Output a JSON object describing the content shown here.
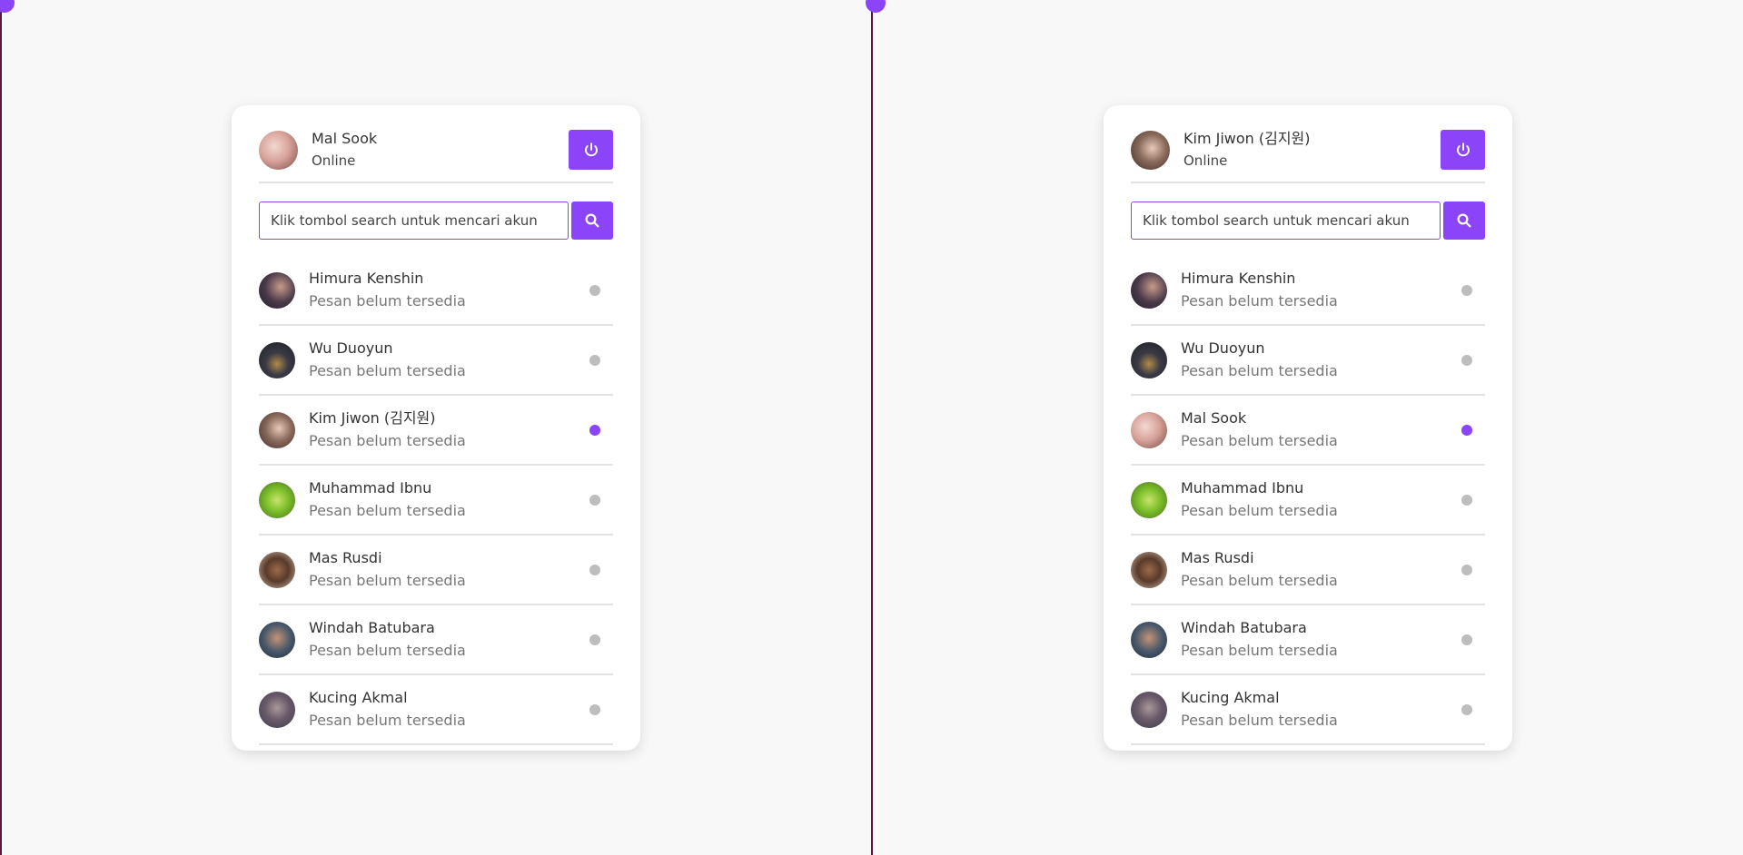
{
  "colors": {
    "accent": "#8b44f7",
    "background": "#f8f8f8",
    "divider": "#e2e2e2",
    "dot_inactive": "#bdbdbd"
  },
  "panes": [
    {
      "user": {
        "name": "Mal Sook",
        "status": "Online",
        "avatar": "user-avatar"
      },
      "search": {
        "placeholder": "Klik tombol search untuk mencari akun"
      },
      "contacts": [
        {
          "name": "Himura Kenshin",
          "message": "Pesan belum tersedia",
          "online": false
        },
        {
          "name": "Wu Duoyun",
          "message": "Pesan belum tersedia",
          "online": false
        },
        {
          "name": "Kim Jiwon (김지원)",
          "message": "Pesan belum tersedia",
          "online": true
        },
        {
          "name": "Muhammad Ibnu",
          "message": "Pesan belum tersedia",
          "online": false
        },
        {
          "name": "Mas Rusdi",
          "message": "Pesan belum tersedia",
          "online": false
        },
        {
          "name": "Windah Batubara",
          "message": "Pesan belum tersedia",
          "online": false
        },
        {
          "name": "Kucing Akmal",
          "message": "Pesan belum tersedia",
          "online": false
        }
      ]
    },
    {
      "user": {
        "name": "Kim Jiwon (김지원)",
        "status": "Online",
        "avatar": "user-avatar"
      },
      "search": {
        "placeholder": "Klik tombol search untuk mencari akun"
      },
      "contacts": [
        {
          "name": "Himura Kenshin",
          "message": "Pesan belum tersedia",
          "online": false
        },
        {
          "name": "Wu Duoyun",
          "message": "Pesan belum tersedia",
          "online": false
        },
        {
          "name": "Mal Sook",
          "message": "Pesan belum tersedia",
          "online": true
        },
        {
          "name": "Muhammad Ibnu",
          "message": "Pesan belum tersedia",
          "online": false
        },
        {
          "name": "Mas Rusdi",
          "message": "Pesan belum tersedia",
          "online": false
        },
        {
          "name": "Windah Batubara",
          "message": "Pesan belum tersedia",
          "online": false
        },
        {
          "name": "Kucing Akmal",
          "message": "Pesan belum tersedia",
          "online": false
        }
      ]
    }
  ],
  "icons": {
    "logout": "power-icon",
    "search": "search-icon"
  }
}
